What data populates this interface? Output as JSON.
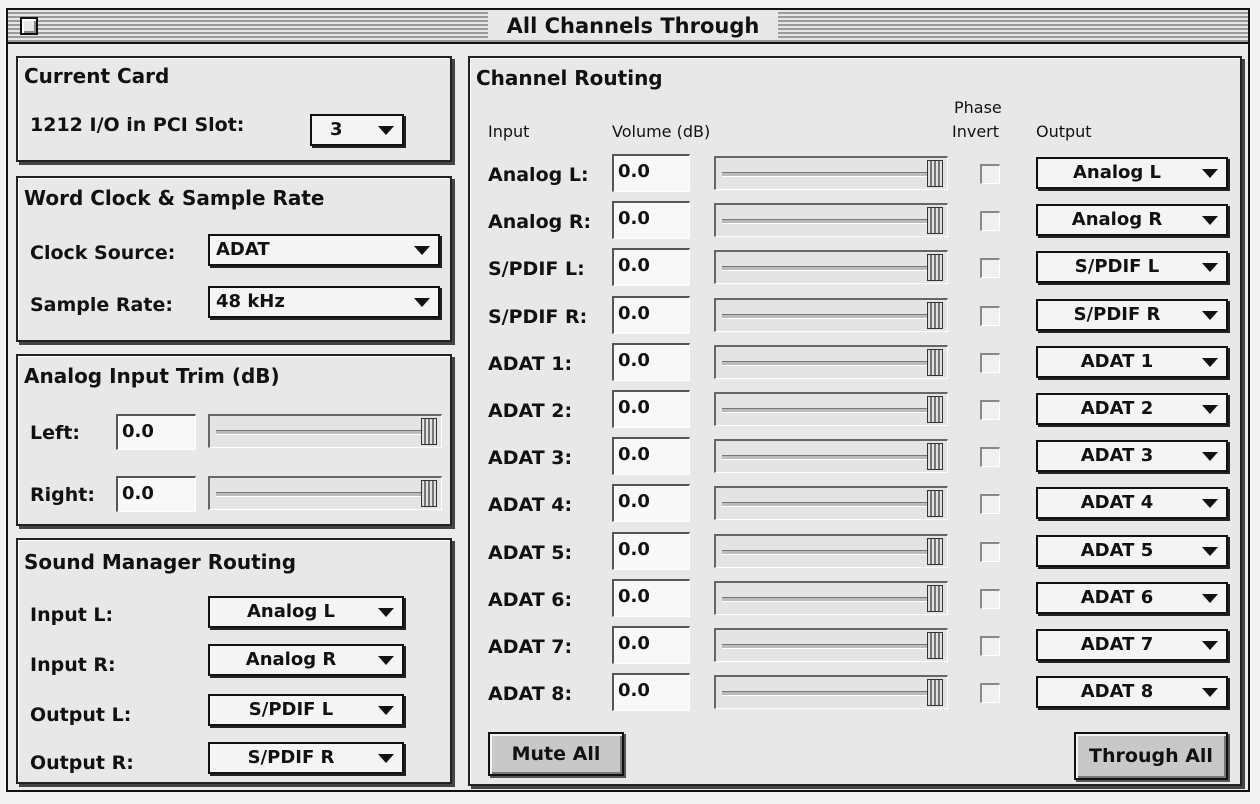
{
  "window": {
    "title": "All Channels Through"
  },
  "current_card": {
    "title": "Current Card",
    "slot_label": "1212 I/O in PCI Slot:",
    "slot_value": "3"
  },
  "clock": {
    "title": "Word Clock & Sample Rate",
    "source_label": "Clock Source:",
    "source_value": "ADAT",
    "rate_label": "Sample Rate:",
    "rate_value": "48 kHz"
  },
  "trim": {
    "title": "Analog Input Trim (dB)",
    "left_label": "Left:",
    "left_value": "0.0",
    "left_level": 1.0,
    "right_label": "Right:",
    "right_value": "0.0",
    "right_level": 1.0
  },
  "sound_manager": {
    "title": "Sound Manager Routing",
    "rows": [
      {
        "label": "Input L:",
        "value": "Analog L"
      },
      {
        "label": "Input R:",
        "value": "Analog R"
      },
      {
        "label": "Output L:",
        "value": "S/PDIF L"
      },
      {
        "label": "Output R:",
        "value": "S/PDIF R"
      }
    ]
  },
  "routing": {
    "title": "Channel Routing",
    "headers": {
      "input": "Input",
      "volume": "Volume (dB)",
      "phase_line1": "Phase",
      "phase_line2": "Invert",
      "output": "Output"
    },
    "channels": [
      {
        "input": "Analog L:",
        "volume": "0.0",
        "level": 1.0,
        "invert": false,
        "output": "Analog L"
      },
      {
        "input": "Analog R:",
        "volume": "0.0",
        "level": 1.0,
        "invert": false,
        "output": "Analog R"
      },
      {
        "input": "S/PDIF L:",
        "volume": "0.0",
        "level": 1.0,
        "invert": false,
        "output": "S/PDIF L"
      },
      {
        "input": "S/PDIF R:",
        "volume": "0.0",
        "level": 1.0,
        "invert": false,
        "output": "S/PDIF R"
      },
      {
        "input": "ADAT 1:",
        "volume": "0.0",
        "level": 1.0,
        "invert": false,
        "output": "ADAT 1"
      },
      {
        "input": "ADAT 2:",
        "volume": "0.0",
        "level": 1.0,
        "invert": false,
        "output": "ADAT 2"
      },
      {
        "input": "ADAT 3:",
        "volume": "0.0",
        "level": 1.0,
        "invert": false,
        "output": "ADAT 3"
      },
      {
        "input": "ADAT 4:",
        "volume": "0.0",
        "level": 1.0,
        "invert": false,
        "output": "ADAT 4"
      },
      {
        "input": "ADAT 5:",
        "volume": "0.0",
        "level": 1.0,
        "invert": false,
        "output": "ADAT 5"
      },
      {
        "input": "ADAT 6:",
        "volume": "0.0",
        "level": 1.0,
        "invert": false,
        "output": "ADAT 6"
      },
      {
        "input": "ADAT 7:",
        "volume": "0.0",
        "level": 1.0,
        "invert": false,
        "output": "ADAT 7"
      },
      {
        "input": "ADAT 8:",
        "volume": "0.0",
        "level": 1.0,
        "invert": false,
        "output": "ADAT 8"
      }
    ],
    "mute_all_label": "Mute All",
    "through_all_label": "Through All"
  }
}
